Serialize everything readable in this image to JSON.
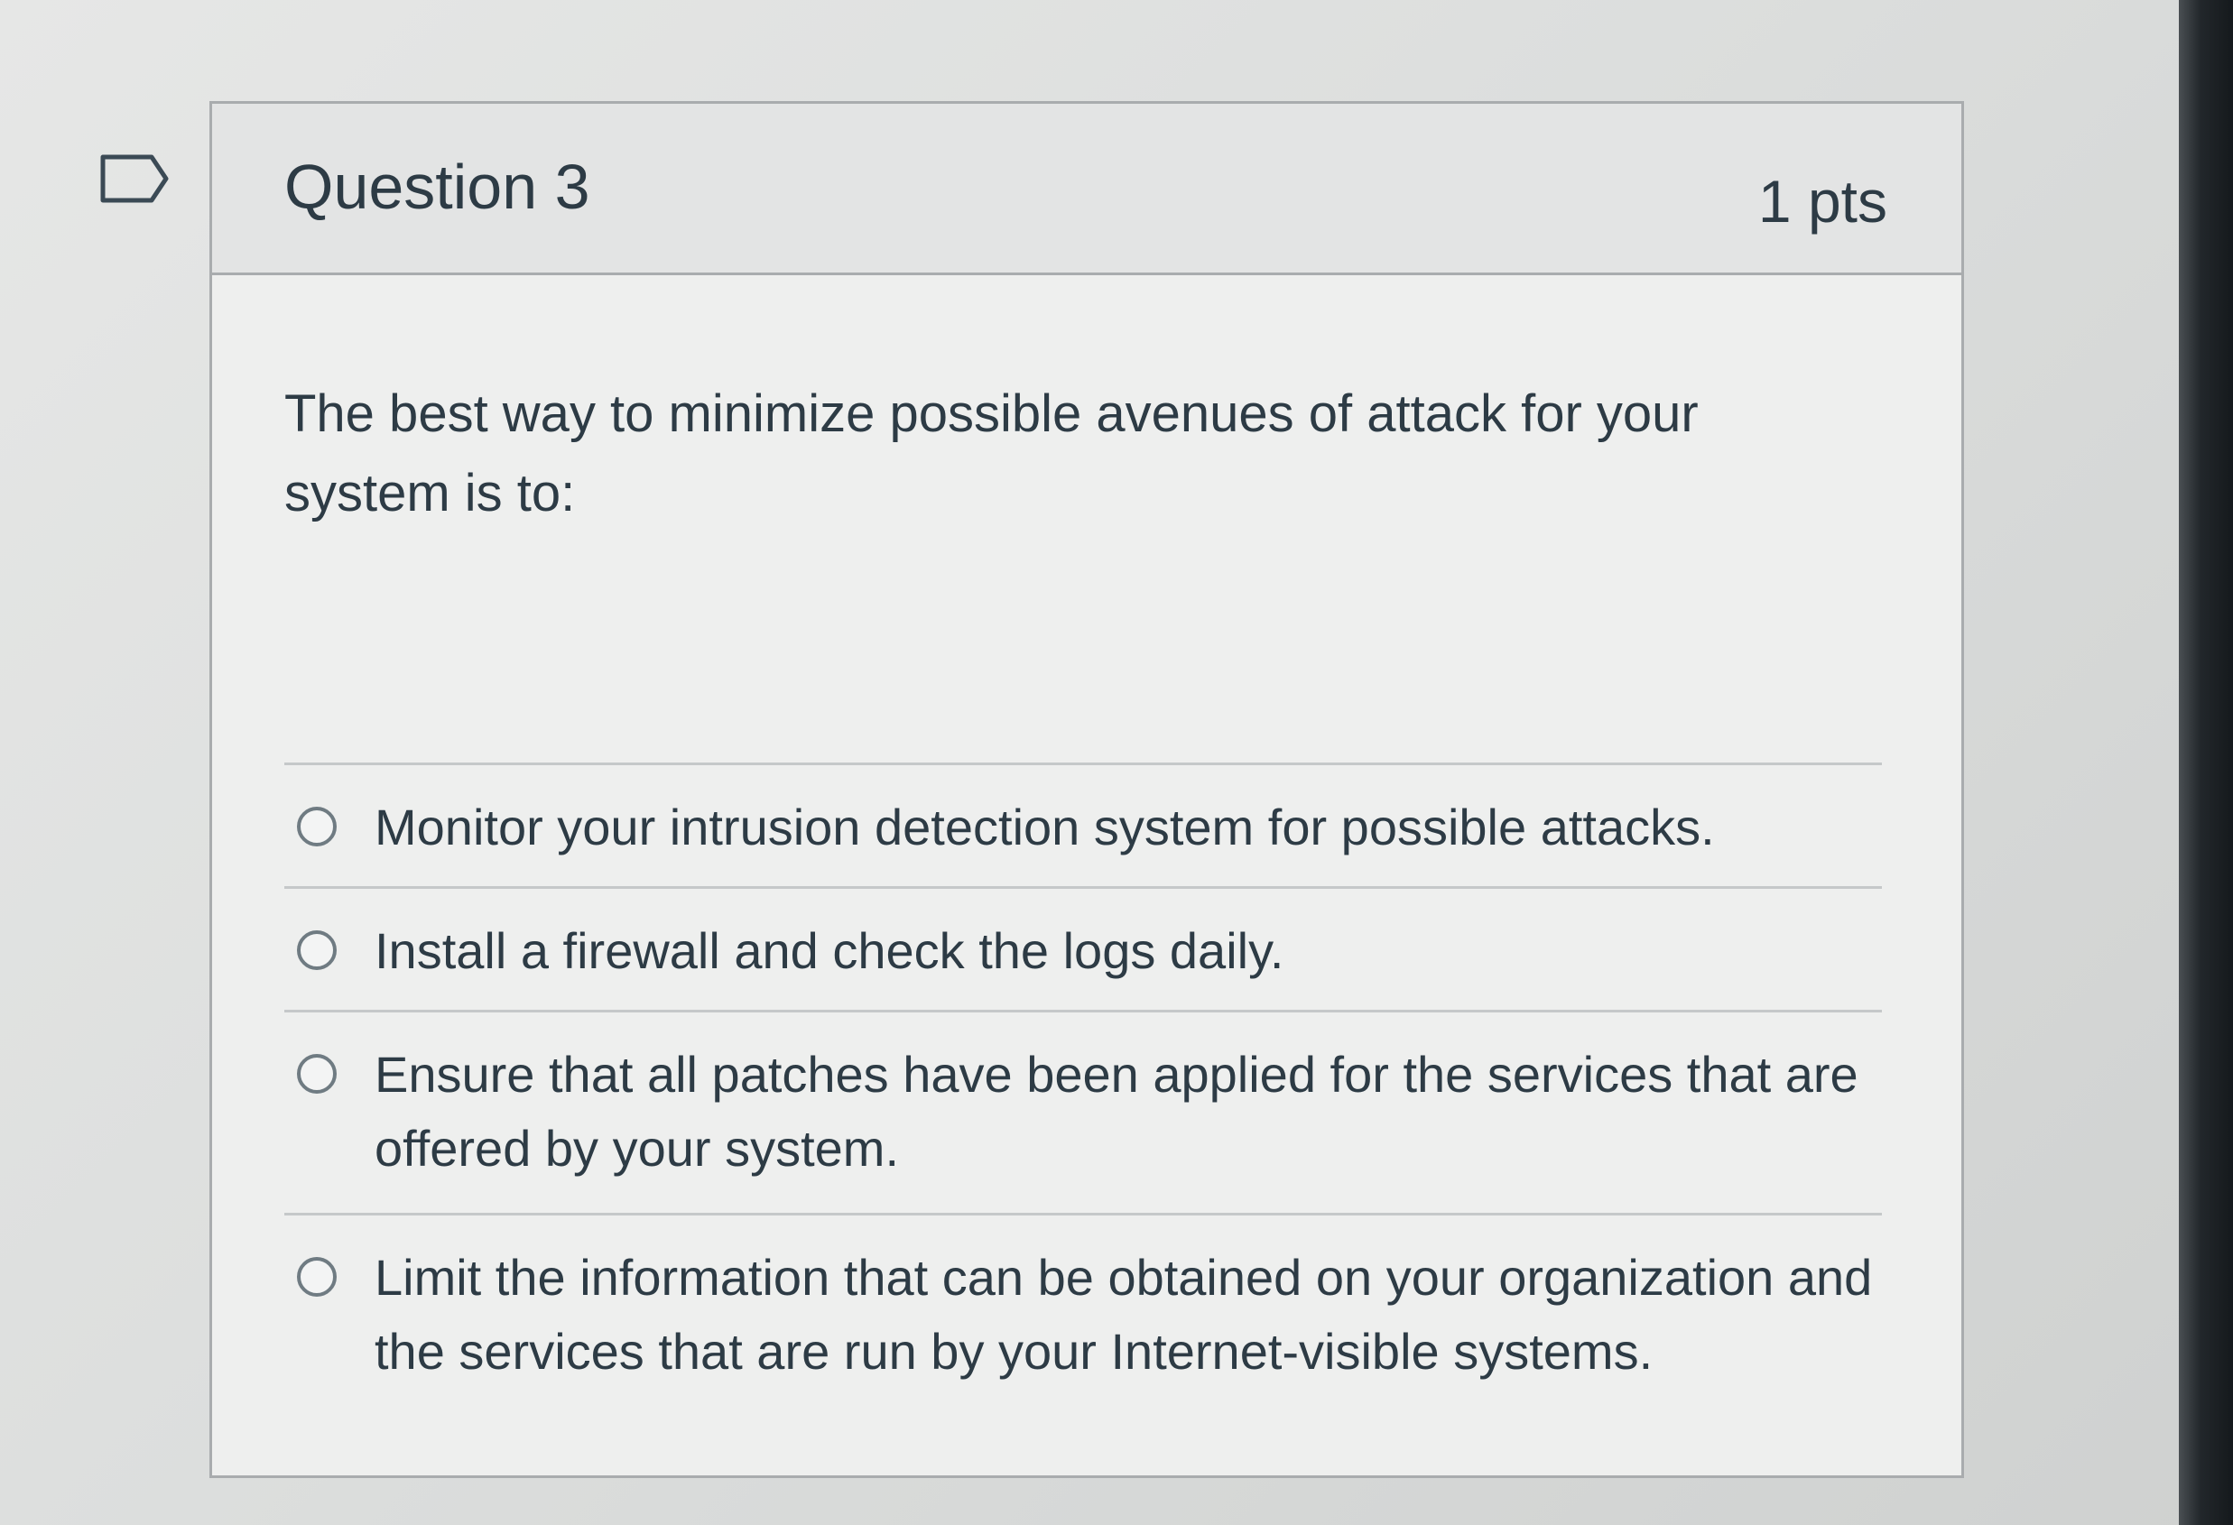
{
  "question": {
    "title": "Question 3",
    "points": "1 pts",
    "text": "The best way to minimize possible avenues of attack for your system is to:"
  },
  "answers": [
    {
      "label": "Monitor your intrusion detection system for possible attacks.",
      "selected": false
    },
    {
      "label": "Install a firewall and check the logs daily.",
      "selected": false
    },
    {
      "label": "Ensure that all patches have been applied for the services that are offered by your system.",
      "selected": false
    },
    {
      "label": "Limit the information that can be obtained on your organization and the services that are run by your Internet-visible systems.",
      "selected": false
    }
  ],
  "icons": {
    "flag": "flag-icon",
    "radio": "radio-unselected-icon"
  },
  "colors": {
    "text": "#2d3b45",
    "border": "#a9acae",
    "header_background": "#e3e4e4"
  }
}
